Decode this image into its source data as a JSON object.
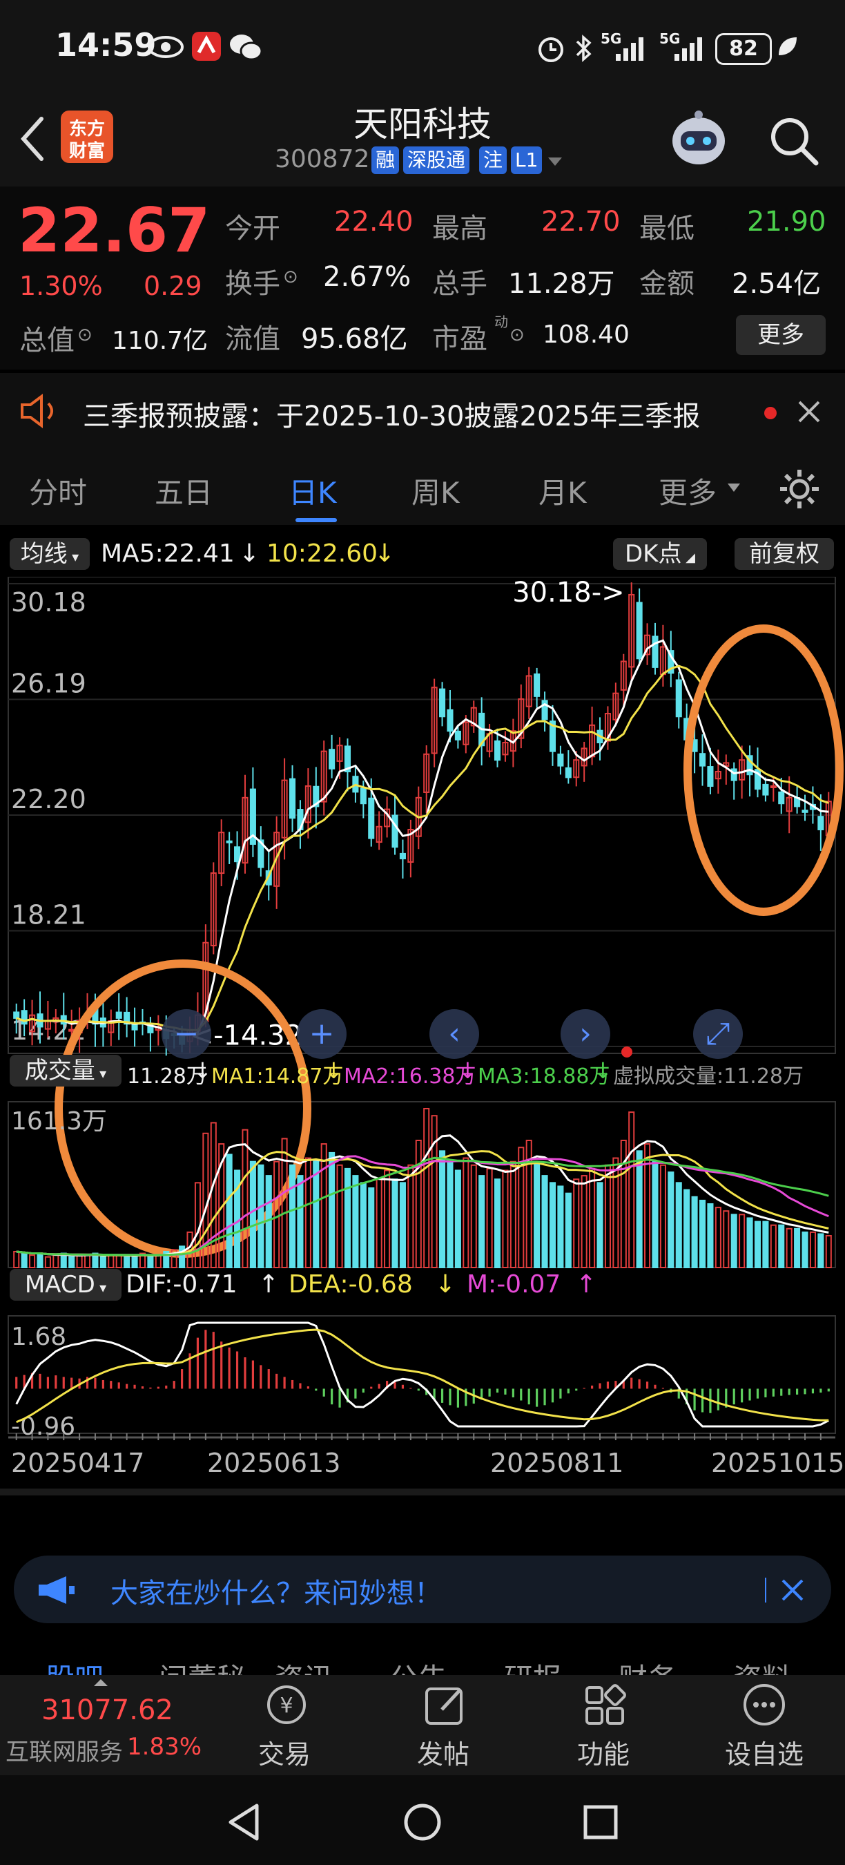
{
  "status_bar": {
    "time": "14:59",
    "net1": "5G",
    "net2": "5G",
    "battery": "82",
    "icons": [
      "eye-icon",
      "app-icon",
      "wechat-icon",
      "alarm-icon",
      "bluetooth-icon",
      "signal-icon",
      "leaf-icon"
    ]
  },
  "header": {
    "logo_line1": "东方",
    "logo_line2": "财富",
    "stock_name": "天阳科技",
    "stock_code": "300872",
    "badges": [
      "融",
      "深股通",
      "注",
      "L1"
    ]
  },
  "quote": {
    "price": "22.67",
    "change_pct": "1.30%",
    "change_amt": "0.29",
    "open_label": "今开",
    "open": "22.40",
    "high_label": "最高",
    "high": "22.70",
    "low_label": "最低",
    "low": "21.90",
    "turnover_label": "换手",
    "turnover": "2.67%",
    "volume_label": "总手",
    "volume": "11.28万",
    "amount_label": "金额",
    "amount": "2.54亿",
    "mktcap_label": "总值",
    "mktcap": "110.7亿",
    "float_label": "流值",
    "float_cap": "95.68亿",
    "pe_label": "市盈",
    "pe_sup": "动",
    "pe": "108.40",
    "more_label": "更多"
  },
  "notice": {
    "text": "三季报预披露：于2025-10-30披露2025年三季报"
  },
  "tabs": {
    "items": [
      "分时",
      "五日",
      "日K",
      "周K",
      "月K",
      "更多"
    ],
    "active": 2
  },
  "indicator_bar": {
    "ma_selector": "均线",
    "ma5": "MA5:22.41",
    "ma10": "10:22.60",
    "dk_label": "DK点",
    "adjust_label": "前复权"
  },
  "volume_bar": {
    "selector": "成交量",
    "vol": "11.28万",
    "ma1": "MA1:14.87万",
    "ma2": "MA2:16.38万",
    "ma3": "MA3:18.88万",
    "virtual": "虚拟成交量:11.28万",
    "max_label": "161.3万"
  },
  "macd_bar": {
    "selector": "MACD",
    "dif": "DIF:-0.71",
    "dea": "DEA:-0.68",
    "m": "M:-0.07",
    "top_label": "1.68",
    "bottom_label": "-0.96"
  },
  "chart_data": {
    "type": "candlestick",
    "y_ticks": [
      "30.18",
      "26.19",
      "22.20",
      "18.21",
      "14.22"
    ],
    "ylim": [
      14.22,
      30.18
    ],
    "max_annotation": "30.18->",
    "min_annotation": "<-14.32",
    "x_dates": [
      "20250417",
      "20250613",
      "20250811",
      "20251015"
    ],
    "colors": {
      "up": "#e23d3d",
      "down": "#5ee0ea",
      "ma5": "#ffffff",
      "ma10": "#f2e24a",
      "ma_vol3": "#4ccf4c",
      "circle": "#f08a3c"
    },
    "close": [
      15.2,
      15.0,
      15.3,
      14.9,
      15.1,
      15.2,
      15.0,
      14.8,
      15.1,
      15.3,
      15.0,
      14.9,
      15.1,
      15.2,
      15.0,
      14.8,
      15.0,
      14.7,
      14.9,
      14.5,
      14.6,
      14.3,
      14.8,
      15.3,
      17.8,
      20.2,
      21.6,
      21.3,
      20.6,
      22.8,
      21.2,
      20.4,
      19.8,
      21.6,
      23.4,
      22.1,
      21.7,
      23.2,
      22.5,
      24.4,
      23.8,
      24.6,
      23.7,
      23.0,
      22.6,
      21.4,
      21.8,
      22.4,
      21.1,
      20.7,
      21.7,
      22.8,
      24.3,
      26.6,
      25.6,
      25.1,
      24.8,
      25.4,
      25.9,
      24.6,
      25.0,
      24.1,
      24.7,
      25.1,
      26.2,
      27.0,
      26.3,
      25.5,
      24.4,
      23.9,
      23.5,
      24.1,
      24.5,
      25.3,
      24.7,
      25.7,
      26.4,
      27.5,
      29.8,
      27.6,
      28.4,
      27.3,
      28.0,
      27.1,
      25.6,
      24.8,
      24.4,
      23.9,
      23.2,
      23.7,
      24.0,
      23.4,
      24.1,
      23.6,
      23.1,
      22.9,
      23.2,
      22.6,
      22.8,
      22.5,
      22.3,
      22.4,
      21.7,
      22.67
    ],
    "volume": [
      9,
      8,
      7,
      8,
      6,
      7,
      8,
      6,
      7,
      7,
      8,
      6,
      7,
      7,
      6,
      7,
      8,
      6,
      7,
      9,
      10,
      12,
      20,
      48,
      76,
      82,
      70,
      64,
      55,
      78,
      60,
      58,
      52,
      60,
      73,
      58,
      52,
      62,
      60,
      70,
      65,
      58,
      56,
      52,
      48,
      45,
      50,
      55,
      50,
      48,
      58,
      72,
      90,
      86,
      66,
      60,
      55,
      62,
      58,
      52,
      56,
      50,
      55,
      60,
      68,
      72,
      60,
      52,
      48,
      46,
      42,
      50,
      52,
      56,
      48,
      58,
      62,
      72,
      88,
      66,
      70,
      60,
      58,
      54,
      48,
      44,
      40,
      38,
      36,
      34,
      32,
      30,
      30,
      28,
      26,
      26,
      24,
      24,
      22,
      22,
      20,
      20,
      19,
      18
    ],
    "macd_hist": [
      0.3,
      0.35,
      0.4,
      0.38,
      0.3,
      0.34,
      0.3,
      0.28,
      0.26,
      0.3,
      0.28,
      0.22,
      0.2,
      0.16,
      0.12,
      0.1,
      0.06,
      0.03,
      0.05,
      0.08,
      0.2,
      0.5,
      0.9,
      1.3,
      1.5,
      1.45,
      1.2,
      1.05,
      0.95,
      0.8,
      0.72,
      0.6,
      0.5,
      0.38,
      0.3,
      0.22,
      0.14,
      0.06,
      -0.05,
      -0.2,
      -0.4,
      -0.48,
      -0.35,
      -0.25,
      -0.1,
      0.05,
      0.12,
      0.2,
      0.18,
      0.1,
      0.02,
      -0.05,
      -0.16,
      -0.28,
      -0.36,
      -0.42,
      -0.48,
      -0.44,
      -0.38,
      -0.28,
      -0.2,
      -0.1,
      -0.15,
      -0.22,
      -0.3,
      -0.4,
      -0.46,
      -0.42,
      -0.35,
      -0.25,
      -0.12,
      -0.05,
      0.02,
      0.08,
      0.14,
      0.18,
      0.2,
      0.22,
      0.28,
      0.24,
      0.18,
      0.1,
      0.02,
      -0.1,
      -0.25,
      -0.4,
      -0.55,
      -0.6,
      -0.62,
      -0.55,
      -0.48,
      -0.4,
      -0.35,
      -0.3,
      -0.25,
      -0.22,
      -0.2,
      -0.18,
      -0.16,
      -0.15,
      -0.14,
      -0.12,
      -0.1,
      -0.07
    ]
  },
  "ai_bar": {
    "text": "大家在炒什么？来问妙想！"
  },
  "section_tabs": {
    "items": [
      "股吧",
      "问董秘",
      "资讯",
      "公告",
      "研报",
      "财务",
      "资料"
    ]
  },
  "bottom_nav": {
    "index_value": "31077.62",
    "sector_name": "互联网服务",
    "sector_pct": "1.83%",
    "items": [
      "交易",
      "发帖",
      "功能",
      "设自选"
    ]
  }
}
